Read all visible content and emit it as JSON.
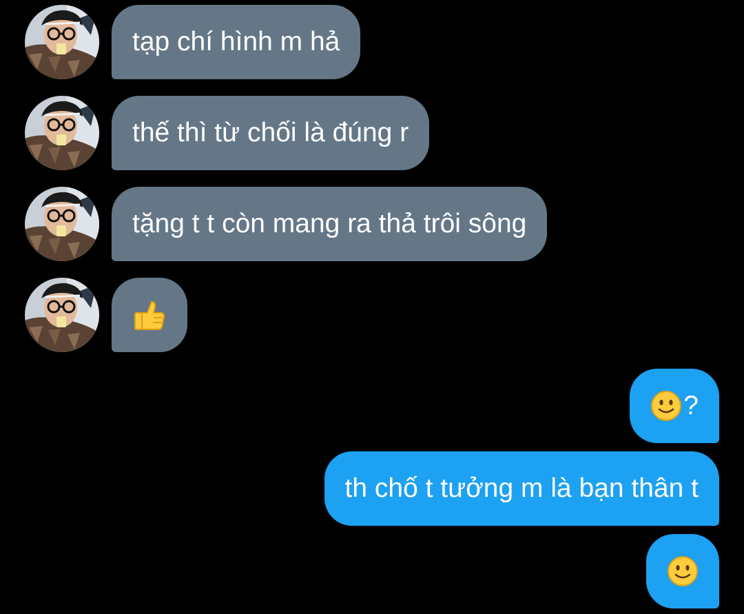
{
  "conversation": {
    "incoming": [
      {
        "text": "tạp chí hình m hả"
      },
      {
        "text": "thế thì từ chối là đúng r"
      },
      {
        "text": "tặng t t còn mang ra thả trôi sông"
      },
      {
        "text": "",
        "emoji": "thumbs-up-icon"
      }
    ],
    "outgoing": [
      {
        "emoji": "slight-smile-icon",
        "text": "?"
      },
      {
        "text": "th chố t tưởng m là bạn thân t"
      },
      {
        "emoji": "slight-smile-icon",
        "text": ""
      }
    ]
  },
  "colors": {
    "background": "#000000",
    "incoming_bubble": "#657787",
    "outgoing_bubble": "#1da1f2",
    "text": "#ffffff"
  }
}
